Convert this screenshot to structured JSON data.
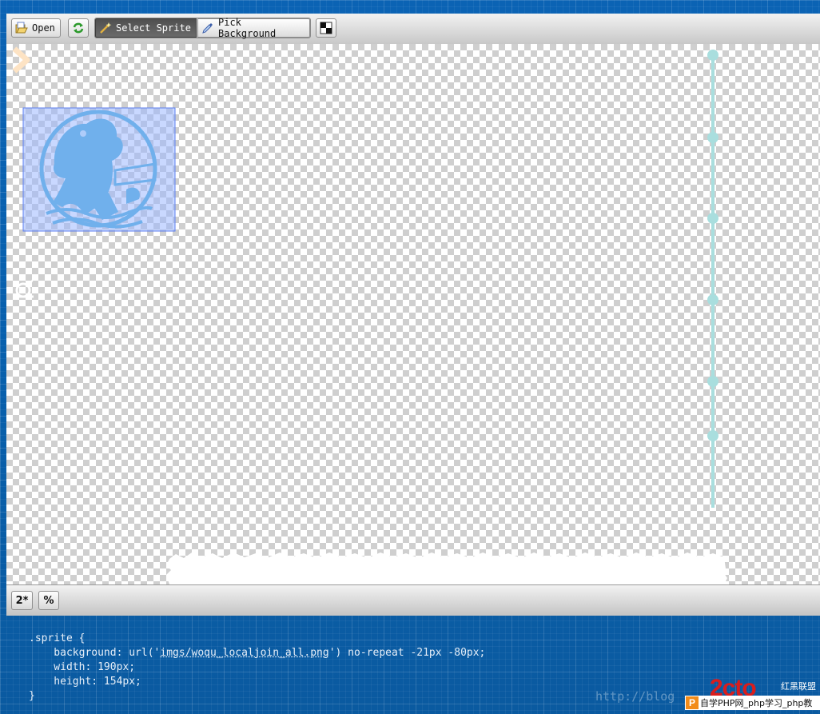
{
  "toolbar": {
    "open_label": "Open",
    "select_sprite_label": "Select Sprite",
    "pick_background_label": "Pick Background"
  },
  "statusbar": {
    "zoom_label": "2*",
    "percent_label": "%"
  },
  "code": {
    "line1": ".sprite {",
    "line2_prefix": "    background: url('",
    "line2_path": "imgs/woqu_localjoin_all.png",
    "line2_suffix": "') no-repeat -21px -80px;",
    "line3": "    width: 190px;",
    "line4": "    height: 154px;",
    "line5": "}"
  },
  "watermark": {
    "url": "http://blog",
    "logo_text": "2cto",
    "logo_cn": "红黑联盟",
    "bar_icon": "P",
    "bar_text": "自学PHP网_php学习_php教"
  },
  "colors": {
    "selection_fill": "#9db8ff",
    "selection_border": "#5c7ff0",
    "sprite_blue": "#3ba6d6",
    "timeline": "#a9dede",
    "active_button": "#555555"
  },
  "icons": [
    "folder-open-icon",
    "refresh-icon",
    "magic-wand-icon",
    "eyedropper-icon",
    "checker-bg-icon",
    "chevron-icon",
    "snail-icon"
  ]
}
